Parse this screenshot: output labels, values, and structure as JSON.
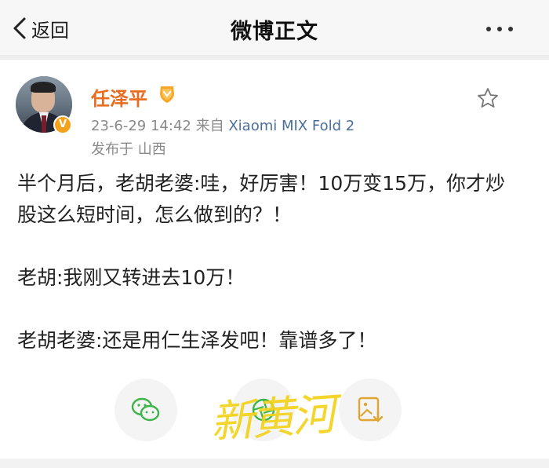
{
  "navbar": {
    "back_label": "返回",
    "title": "微博正文",
    "more_icon": "more-dots-icon"
  },
  "post": {
    "author": "任泽平",
    "author_color": "#e86b1f",
    "verified_badge": "V",
    "timestamp": "23-6-29 14:42",
    "source_prefix": "来自",
    "device": "Xiaomi MIX Fold 2",
    "location": "发布于 山西",
    "paragraphs": [
      "半个月后，老胡老婆:哇，好厉害！10万变15万，你才炒股这么短时间，怎么做到的？！",
      "老胡:我刚又转进去10万！",
      "老胡老婆:还是用仁生泽发吧！靠谱多了！"
    ]
  },
  "actions": {
    "share_wechat_icon": "wechat-icon",
    "share_moments_icon": "wechat-moments-icon",
    "save_image_icon": "save-image-icon"
  },
  "watermark": "新黄河"
}
